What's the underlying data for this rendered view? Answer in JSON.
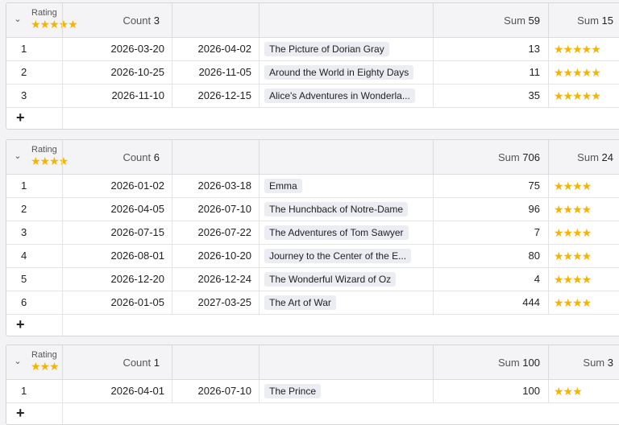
{
  "group_label": "Rating",
  "add_row_label": "+",
  "groups": [
    {
      "rating_stars": "★★★★★",
      "count_label": "Count",
      "count": "3",
      "sum_num_label": "Sum",
      "sum_num": "59",
      "sum_rating_label": "Sum",
      "sum_rating": "15",
      "rows": [
        {
          "index": "1",
          "start": "2026-03-20",
          "end": "2026-04-02",
          "title": "The Picture of Dorian Gray",
          "number": "13",
          "stars": "★★★★★"
        },
        {
          "index": "2",
          "start": "2026-10-25",
          "end": "2026-11-05",
          "title": "Around the World in Eighty Days",
          "number": "11",
          "stars": "★★★★★"
        },
        {
          "index": "3",
          "start": "2026-11-10",
          "end": "2026-12-15",
          "title": "Alice's Adventures in Wonderla...",
          "number": "35",
          "stars": "★★★★★"
        }
      ]
    },
    {
      "rating_stars": "★★★★",
      "count_label": "Count",
      "count": "6",
      "sum_num_label": "Sum",
      "sum_num": "706",
      "sum_rating_label": "Sum",
      "sum_rating": "24",
      "rows": [
        {
          "index": "1",
          "start": "2026-01-02",
          "end": "2026-03-18",
          "title": "Emma",
          "number": "75",
          "stars": "★★★★"
        },
        {
          "index": "2",
          "start": "2026-04-05",
          "end": "2026-07-10",
          "title": "The Hunchback of Notre-Dame",
          "number": "96",
          "stars": "★★★★"
        },
        {
          "index": "3",
          "start": "2026-07-15",
          "end": "2026-07-22",
          "title": "The Adventures of Tom Sawyer",
          "number": "7",
          "stars": "★★★★"
        },
        {
          "index": "4",
          "start": "2026-08-01",
          "end": "2026-10-20",
          "title": "Journey to the Center of the E...",
          "number": "80",
          "stars": "★★★★"
        },
        {
          "index": "5",
          "start": "2026-12-20",
          "end": "2026-12-24",
          "title": "The Wonderful Wizard of Oz",
          "number": "4",
          "stars": "★★★★"
        },
        {
          "index": "6",
          "start": "2026-01-05",
          "end": "2027-03-25",
          "title": "The Art of War",
          "number": "444",
          "stars": "★★★★"
        }
      ]
    },
    {
      "rating_stars": "★★★",
      "count_label": "Count",
      "count": "1",
      "sum_num_label": "Sum",
      "sum_num": "100",
      "sum_rating_label": "Sum",
      "sum_rating": "3",
      "rows": [
        {
          "index": "1",
          "start": "2026-04-01",
          "end": "2026-07-10",
          "title": "The Prince",
          "number": "100",
          "stars": "★★★"
        }
      ]
    }
  ],
  "colors": {
    "star": "#f5b400",
    "header_bg": "#f4f4f6",
    "chip_bg": "#ebedf2"
  }
}
